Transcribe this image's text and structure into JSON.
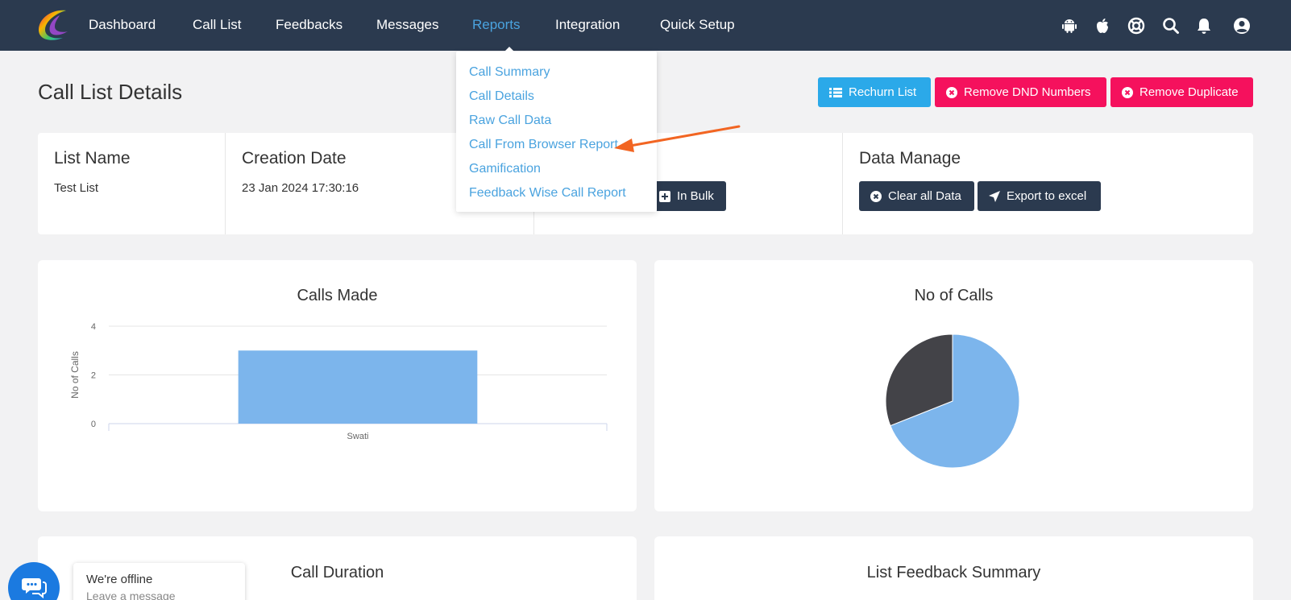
{
  "nav": {
    "items": [
      {
        "label": "Dashboard"
      },
      {
        "label": "Call List"
      },
      {
        "label": "Feedbacks"
      },
      {
        "label": "Messages"
      },
      {
        "label": "Reports"
      },
      {
        "label": "Integration"
      },
      {
        "label": "Quick Setup"
      }
    ],
    "active_item": "Reports",
    "right_icons": [
      "android-icon",
      "apple-icon",
      "support-icon",
      "search-icon",
      "bell-icon",
      "user-icon"
    ]
  },
  "reports_menu": {
    "items": [
      {
        "label": "Call Summary"
      },
      {
        "label": "Call Details"
      },
      {
        "label": "Raw Call Data"
      },
      {
        "label": "Call From Browser Report"
      },
      {
        "label": "Gamification"
      },
      {
        "label": "Feedback Wise Call Report"
      }
    ]
  },
  "page": {
    "title": "Call List Details",
    "actions": {
      "rechurn": "Rechurn List",
      "remove_dnd": "Remove DND Numbers",
      "remove_duplicate": "Remove Duplicate"
    }
  },
  "info": {
    "list_name_label": "List Name",
    "list_name_value": "Test List",
    "creation_date_label": "Creation Date",
    "creation_date_value": "23 Jan 2024 17:30:16",
    "in_bulk_label": "In Bulk",
    "data_manage_label": "Data Manage",
    "clear_all_label": "Clear all Data",
    "export_label": "Export to excel"
  },
  "cards": {
    "calls_made_title": "Calls Made",
    "no_of_calls_title": "No of Calls",
    "call_duration_title": "Call Duration",
    "feedback_summary_title": "List Feedback Summary"
  },
  "chart_data": [
    {
      "type": "bar",
      "title": "Calls Made",
      "categories": [
        "Swati"
      ],
      "values": [
        3
      ],
      "ylabel": "No of Calls",
      "xlabel": "",
      "ylim": [
        0,
        4
      ],
      "yticks": [
        "0",
        "2",
        "4"
      ],
      "grid": true,
      "color": "#7cb5ec"
    },
    {
      "type": "pie",
      "title": "No of Calls",
      "slices": [
        {
          "value": 69,
          "color": "#7cb5ec"
        },
        {
          "value": 31,
          "color": "#434348"
        }
      ]
    }
  ],
  "chat": {
    "title": "We're offline",
    "subtitle": "Leave a message"
  },
  "colors": {
    "navbar": "#2b3a4f",
    "accent_blue": "#4aa3df",
    "button_blue": "#2ba9e9",
    "button_red": "#f5115d",
    "chat_blue": "#1b7ae0",
    "arrow_orange": "#f26522"
  }
}
